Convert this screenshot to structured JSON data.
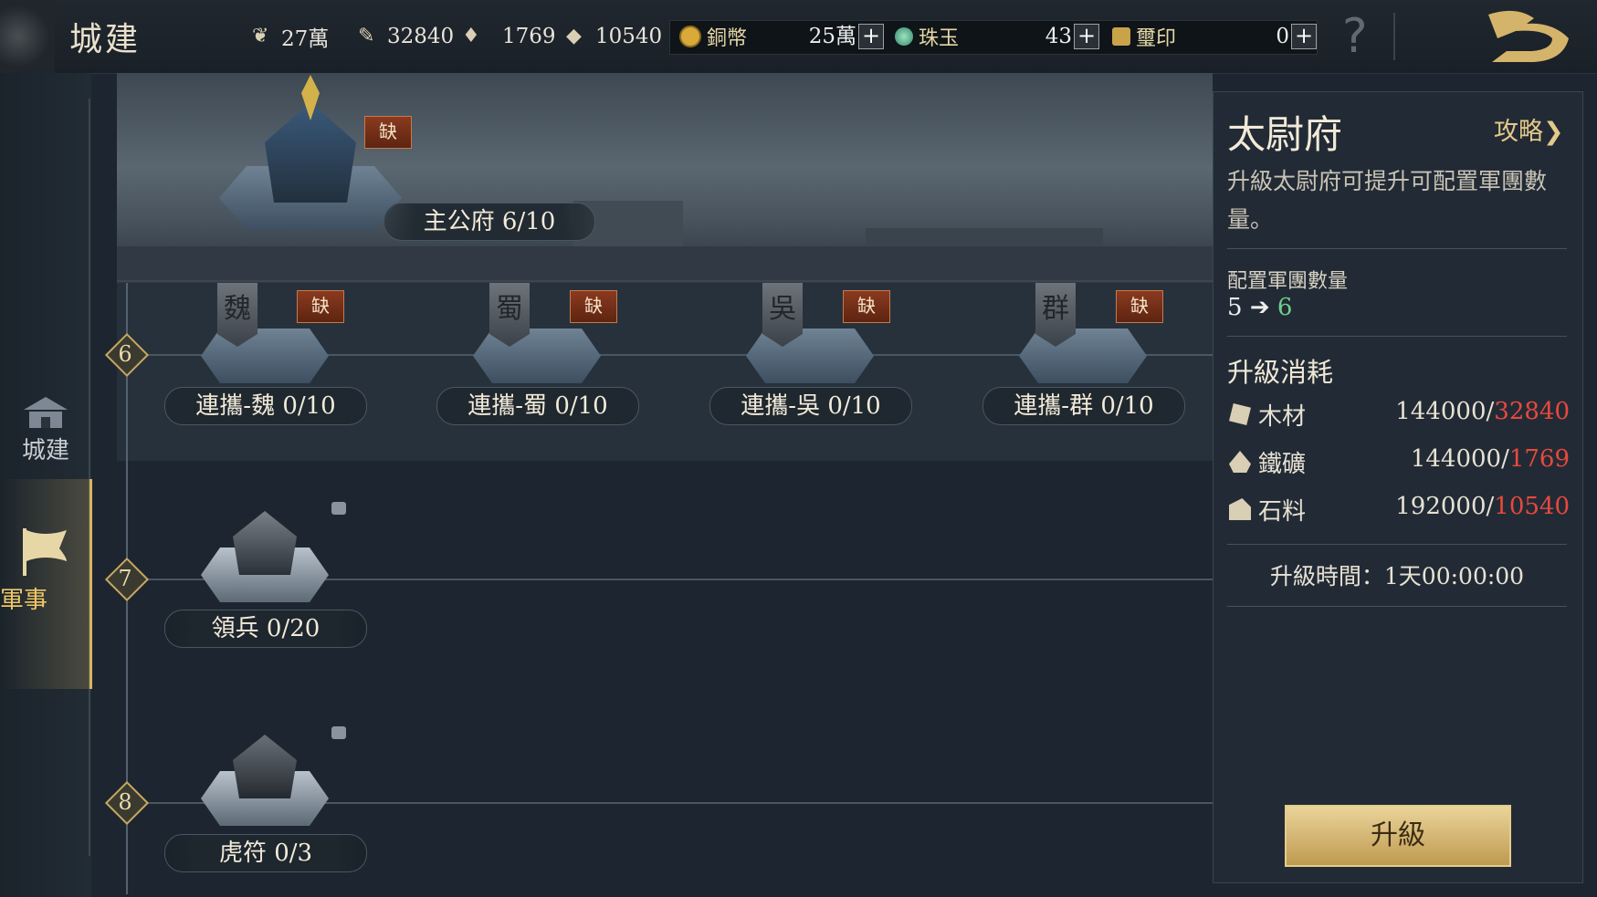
{
  "header": {
    "title": "城建",
    "resources": [
      {
        "icon": "grain-icon",
        "value": "27萬"
      },
      {
        "icon": "wood-icon",
        "value": "32840"
      },
      {
        "icon": "iron-icon",
        "value": "1769"
      },
      {
        "icon": "stone-icon",
        "value": "10540"
      }
    ],
    "currencies": [
      {
        "icon": "copper-coin-icon",
        "label": "銅幣",
        "value": "25萬",
        "color": "#d9a93a"
      },
      {
        "icon": "jade-icon",
        "label": "珠玉",
        "value": "43",
        "color": "#4fb08a"
      },
      {
        "icon": "seal-icon",
        "label": "璽印",
        "value": "0",
        "color": "#c9a24a"
      }
    ],
    "plus_label": "+",
    "help_label": "?"
  },
  "sidebar": {
    "items": [
      {
        "label": "城建",
        "icon": "city-gate-icon",
        "active": false
      },
      {
        "label": "軍事",
        "icon": "war-flag-icon",
        "active": true
      }
    ]
  },
  "main": {
    "top_building": {
      "name": "主公府 6/10",
      "tag": "缺"
    },
    "tiers": [
      {
        "level": "6",
        "buildings": [
          {
            "name": "連攜-魏 0/10",
            "tag": "缺",
            "flag": "魏"
          },
          {
            "name": "連攜-蜀 0/10",
            "tag": "缺",
            "flag": "蜀"
          },
          {
            "name": "連攜-吳 0/10",
            "tag": "缺",
            "flag": "吳"
          },
          {
            "name": "連攜-群 0/10",
            "tag": "缺",
            "flag": "群"
          }
        ]
      },
      {
        "level": "7",
        "buildings": [
          {
            "name": "領兵 0/20",
            "locked": true
          }
        ]
      },
      {
        "level": "8",
        "buildings": [
          {
            "name": "虎符 0/3",
            "locked": true
          }
        ]
      }
    ]
  },
  "panel": {
    "title": "太尉府",
    "guide_label": "攻略❯",
    "description": "升級太尉府可提升可配置軍團數量。",
    "slots_label": "配置軍團數量",
    "slots_from": "5",
    "slots_arrow": "➔",
    "slots_to": "6",
    "cost_title": "升級消耗",
    "costs": [
      {
        "icon": "wood-icon",
        "label": "木材",
        "required": "144000/",
        "owned": "32840"
      },
      {
        "icon": "iron-icon",
        "label": "鐵礦",
        "required": "144000/",
        "owned": "1769"
      },
      {
        "icon": "stone-icon",
        "label": "石料",
        "required": "192000/",
        "owned": "10540"
      }
    ],
    "time_label": "升級時間：",
    "time_value": "1天00:00:00",
    "upgrade_label": "升級"
  }
}
